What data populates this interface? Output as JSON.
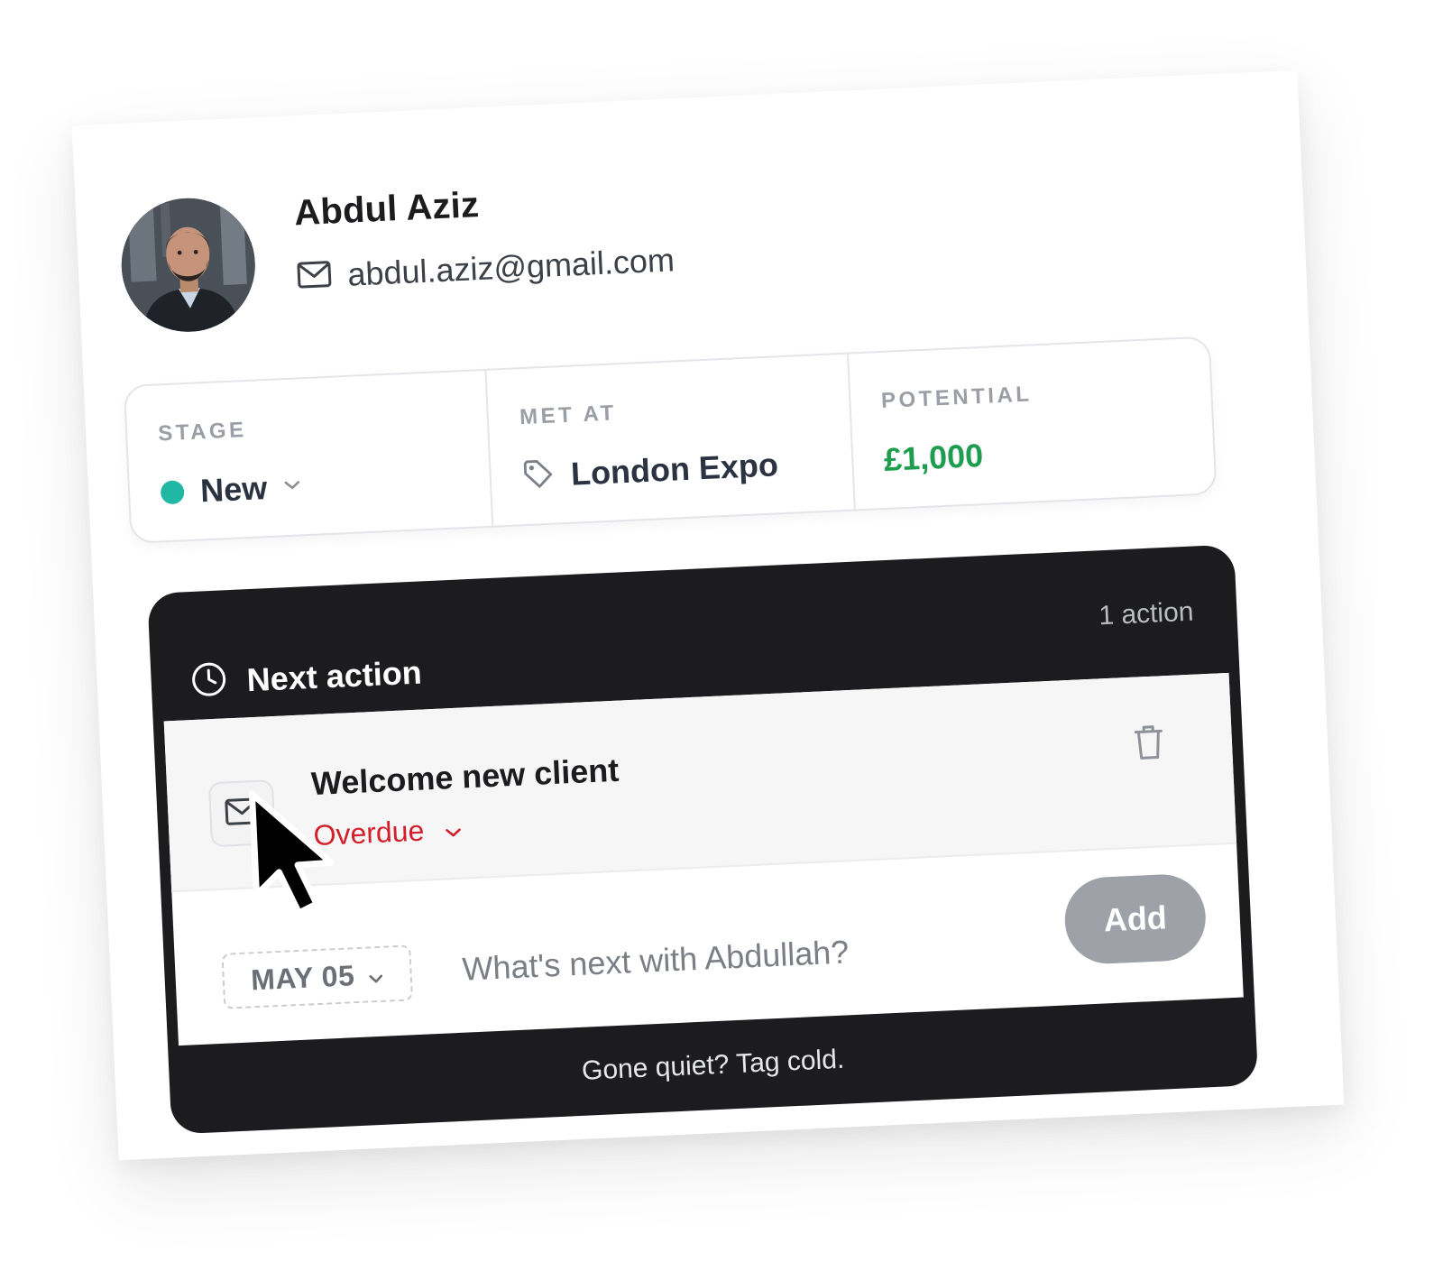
{
  "contact": {
    "name": "Abdul Aziz",
    "email": "abdul.aziz@gmail.com",
    "avatar_icon": "person-photo"
  },
  "stats": {
    "stage": {
      "label": "STAGE",
      "value": "New",
      "dot_color": "#20b8a4"
    },
    "met_at": {
      "label": "MET AT",
      "value": "London Expo",
      "icon": "tag-icon"
    },
    "potential": {
      "label": "POTENTIAL",
      "value": "£1,000",
      "color": "#1f9d4f"
    }
  },
  "next_action": {
    "title": "Next action",
    "count": "1 action",
    "task": {
      "title": "Welcome new client",
      "status": "Overdue",
      "status_color": "#d21f2b",
      "icon": "mail-icon"
    },
    "composer": {
      "date": "MAY 05",
      "placeholder": "What's next with Abdullah?",
      "add_label": "Add"
    },
    "footer": "Gone quiet? Tag cold."
  },
  "colors": {
    "panel_bg": "#1c1c1e",
    "accent_teal": "#20b8a4",
    "add_button": "#9ea2a8"
  }
}
